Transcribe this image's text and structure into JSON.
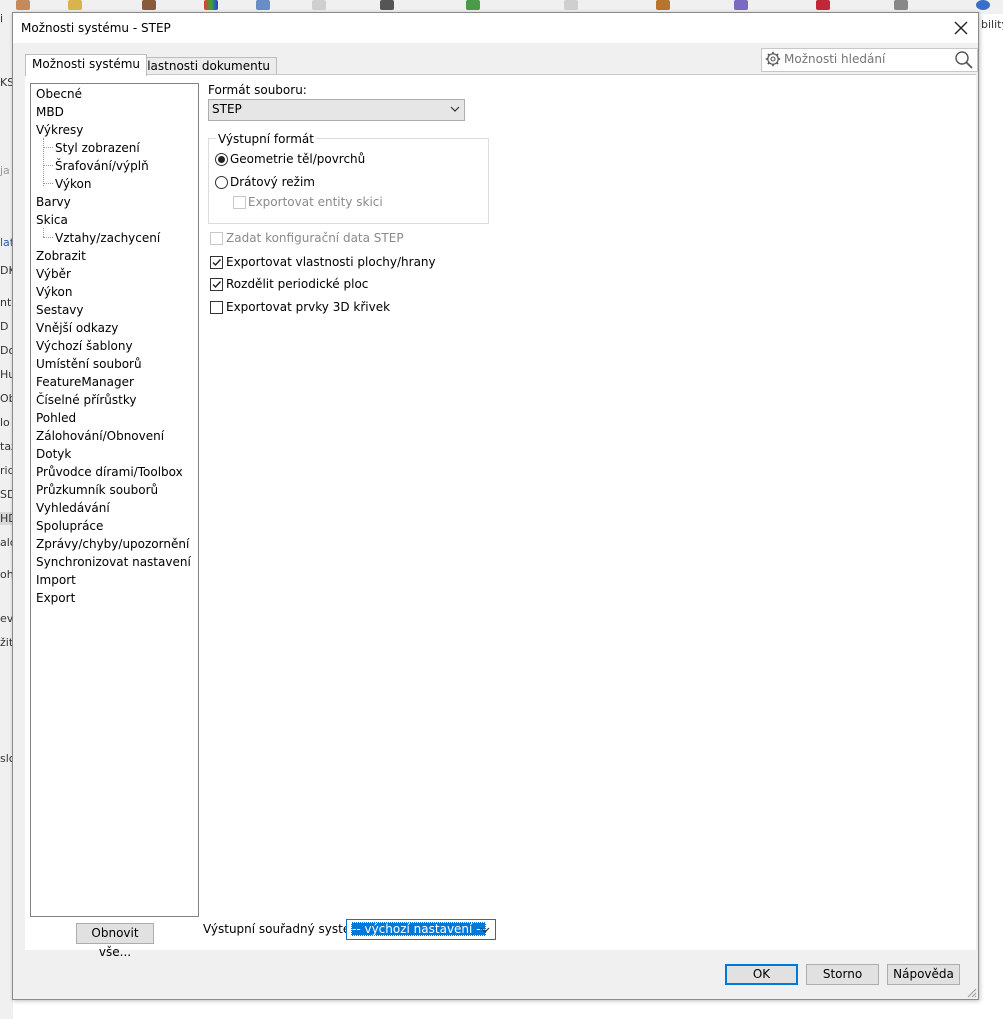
{
  "window": {
    "title": "Možnosti systému - STEP",
    "close_glyph": "✕"
  },
  "tabs": [
    {
      "label": "Možnosti systému",
      "active": true
    },
    {
      "label": "Vlastnosti dokumentu",
      "active": false
    }
  ],
  "search": {
    "placeholder": "Možnosti hledání",
    "gear_icon": "gear-icon",
    "search_icon": "search-icon"
  },
  "sidebar": {
    "items": [
      {
        "label": "Obecné",
        "level": 0
      },
      {
        "label": "MBD",
        "level": 0
      },
      {
        "label": "Výkresy",
        "level": 0
      },
      {
        "label": "Styl zobrazení",
        "level": 1
      },
      {
        "label": "Šrafování/výplň",
        "level": 1
      },
      {
        "label": "Výkon",
        "level": 1
      },
      {
        "label": "Barvy",
        "level": 0
      },
      {
        "label": "Skica",
        "level": 0
      },
      {
        "label": "Vztahy/zachycení",
        "level": 1
      },
      {
        "label": "Zobrazit",
        "level": 0
      },
      {
        "label": "Výběr",
        "level": 0
      },
      {
        "label": "Výkon",
        "level": 0
      },
      {
        "label": "Sestavy",
        "level": 0
      },
      {
        "label": "Vnější odkazy",
        "level": 0
      },
      {
        "label": "Výchozí šablony",
        "level": 0
      },
      {
        "label": "Umístění souborů",
        "level": 0
      },
      {
        "label": "FeatureManager",
        "level": 0
      },
      {
        "label": "Číselné přírůstky",
        "level": 0
      },
      {
        "label": "Pohled",
        "level": 0
      },
      {
        "label": "Zálohování/Obnovení",
        "level": 0
      },
      {
        "label": "Dotyk",
        "level": 0
      },
      {
        "label": "Průvodce dírami/Toolbox",
        "level": 0
      },
      {
        "label": "Průzkumník souborů",
        "level": 0
      },
      {
        "label": "Vyhledávání",
        "level": 0
      },
      {
        "label": "Spolupráce",
        "level": 0
      },
      {
        "label": "Zprávy/chyby/upozornění",
        "level": 0
      },
      {
        "label": "Synchronizovat nastavení",
        "level": 0
      },
      {
        "label": "Import",
        "level": 0
      },
      {
        "label": "Export",
        "level": 0
      }
    ],
    "reset_button": "Obnovit vše..."
  },
  "main": {
    "file_format_label": "Formát souboru:",
    "file_format_value": "STEP",
    "output_format": {
      "title": "Výstupní formát",
      "option_solid": {
        "label": "Geometrie těl/povrchů",
        "selected": true
      },
      "option_wire": {
        "label": "Drátový režim",
        "selected": false
      },
      "export_sketch": {
        "label": "Exportovat entity skici",
        "checked": false,
        "enabled": false
      }
    },
    "step_config": {
      "label": "Zadat konfigurační data STEP",
      "checked": false,
      "enabled": false
    },
    "export_face_props": {
      "label": "Exportovat vlastnosti plochy/hrany",
      "checked": true
    },
    "split_periodic": {
      "label": "Rozdělit periodické ploc",
      "checked": true
    },
    "export_3d_curves": {
      "label": "Exportovat prvky 3D křivek",
      "checked": false
    },
    "coord_label": "Výstupní souřadný systém:",
    "coord_value": "-- výchozí nastavení --"
  },
  "footer": {
    "ok": "OK",
    "cancel": "Storno",
    "help": "Nápověda"
  },
  "background": {
    "left_fragments": [
      "i",
      "KS",
      "ja",
      "lat",
      "DK",
      "nto",
      "D",
      "Dok",
      "Hu",
      "Obr",
      "lo",
      "taz",
      "rid",
      "SD",
      "HD",
      "alc",
      "oh",
      "ev",
      "žit",
      "slc"
    ],
    "right_fragment": "bilityS"
  },
  "colors": {
    "accent": "#0078d7",
    "dialog_bg": "#f0f0f0"
  }
}
